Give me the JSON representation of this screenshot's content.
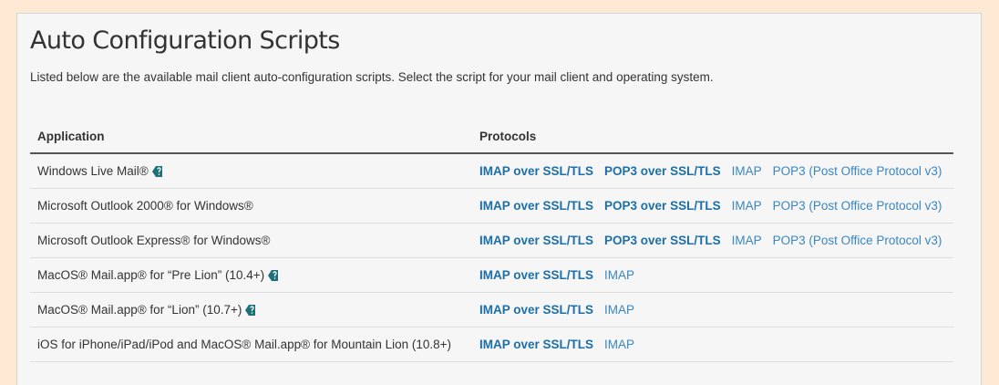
{
  "page": {
    "title": "Auto Configuration Scripts",
    "description": "Listed below are the available mail client auto-configuration scripts. Select the script for your mail client and operating system."
  },
  "table": {
    "headers": {
      "application": "Application",
      "protocols": "Protocols"
    },
    "rows": [
      {
        "application": "Windows Live Mail®",
        "has_info_icon": true,
        "links": [
          "IMAP over SSL/TLS",
          "POP3 over SSL/TLS",
          "IMAP",
          "POP3 (Post Office Protocol v3)"
        ]
      },
      {
        "application": "Microsoft Outlook 2000® for Windows®",
        "has_info_icon": false,
        "links": [
          "IMAP over SSL/TLS",
          "POP3 over SSL/TLS",
          "IMAP",
          "POP3 (Post Office Protocol v3)"
        ]
      },
      {
        "application": "Microsoft Outlook Express® for Windows®",
        "has_info_icon": false,
        "links": [
          "IMAP over SSL/TLS",
          "POP3 over SSL/TLS",
          "IMAP",
          "POP3 (Post Office Protocol v3)"
        ]
      },
      {
        "application": "MacOS® Mail.app® for “Pre Lion” (10.4+)",
        "has_info_icon": true,
        "links": [
          "IMAP over SSL/TLS",
          "IMAP"
        ]
      },
      {
        "application": "MacOS® Mail.app® for “Lion” (10.7+)",
        "has_info_icon": true,
        "links": [
          "IMAP over SSL/TLS",
          "IMAP"
        ]
      },
      {
        "application": "iOS for iPhone/iPad/iPod and MacOS® Mail.app® for Mountain Lion (10.8+)",
        "has_info_icon": false,
        "links": [
          "IMAP over SSL/TLS",
          "IMAP"
        ]
      }
    ]
  },
  "icons": {
    "info": "info-tag-icon"
  },
  "colors": {
    "link": "#1c6fa8",
    "icon": "#1f6f7a",
    "background": "#fde9d4",
    "panel": "#f6f6f6"
  }
}
